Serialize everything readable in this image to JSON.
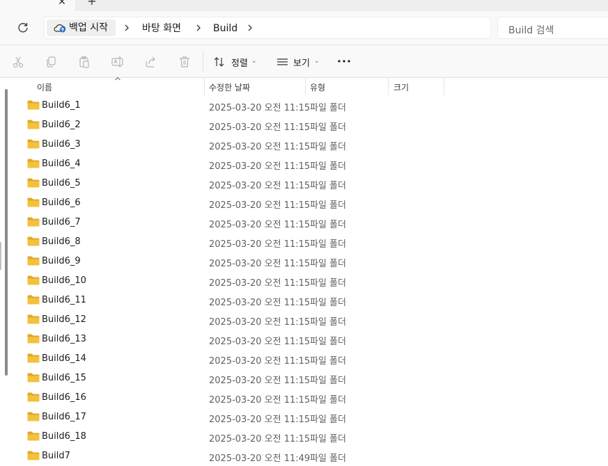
{
  "tabs": {
    "close_glyph": "✕",
    "new_glyph": "+"
  },
  "address": {
    "crumbs": [
      "백업 시작",
      "바탕 화면",
      "Build"
    ],
    "search_placeholder": "Build 검색"
  },
  "toolbar": {
    "icons": [
      "cut-icon",
      "copy-icon",
      "paste-icon",
      "rename-icon",
      "share-icon",
      "delete-icon"
    ],
    "sort_label": "정렬",
    "view_label": "보기",
    "more_glyph": "•••",
    "dropdown_glyph": "⌄"
  },
  "columns": {
    "name": "이름",
    "modified": "수정한 날짜",
    "type": "유형",
    "size": "크기"
  },
  "files": [
    {
      "name": "Build6_1",
      "modified": "2025-03-20 오전 11:15",
      "type": "파일 폴더"
    },
    {
      "name": "Build6_2",
      "modified": "2025-03-20 오전 11:15",
      "type": "파일 폴더"
    },
    {
      "name": "Build6_3",
      "modified": "2025-03-20 오전 11:15",
      "type": "파일 폴더"
    },
    {
      "name": "Build6_4",
      "modified": "2025-03-20 오전 11:15",
      "type": "파일 폴더"
    },
    {
      "name": "Build6_5",
      "modified": "2025-03-20 오전 11:15",
      "type": "파일 폴더"
    },
    {
      "name": "Build6_6",
      "modified": "2025-03-20 오전 11:15",
      "type": "파일 폴더"
    },
    {
      "name": "Build6_7",
      "modified": "2025-03-20 오전 11:15",
      "type": "파일 폴더"
    },
    {
      "name": "Build6_8",
      "modified": "2025-03-20 오전 11:15",
      "type": "파일 폴더"
    },
    {
      "name": "Build6_9",
      "modified": "2025-03-20 오전 11:15",
      "type": "파일 폴더"
    },
    {
      "name": "Build6_10",
      "modified": "2025-03-20 오전 11:15",
      "type": "파일 폴더"
    },
    {
      "name": "Build6_11",
      "modified": "2025-03-20 오전 11:15",
      "type": "파일 폴더"
    },
    {
      "name": "Build6_12",
      "modified": "2025-03-20 오전 11:15",
      "type": "파일 폴더"
    },
    {
      "name": "Build6_13",
      "modified": "2025-03-20 오전 11:15",
      "type": "파일 폴더"
    },
    {
      "name": "Build6_14",
      "modified": "2025-03-20 오전 11:15",
      "type": "파일 폴더"
    },
    {
      "name": "Build6_15",
      "modified": "2025-03-20 오전 11:15",
      "type": "파일 폴더"
    },
    {
      "name": "Build6_16",
      "modified": "2025-03-20 오전 11:15",
      "type": "파일 폴더"
    },
    {
      "name": "Build6_17",
      "modified": "2025-03-20 오전 11:15",
      "type": "파일 폴더"
    },
    {
      "name": "Build6_18",
      "modified": "2025-03-20 오전 11:15",
      "type": "파일 폴더"
    },
    {
      "name": "Build7",
      "modified": "2025-03-20 오전 11:49",
      "type": "파일 폴더"
    }
  ],
  "colors": {
    "folder_yellow": "#f4c13d",
    "folder_back": "#e0a82a",
    "onedrive_blue": "#1f6fd1"
  }
}
